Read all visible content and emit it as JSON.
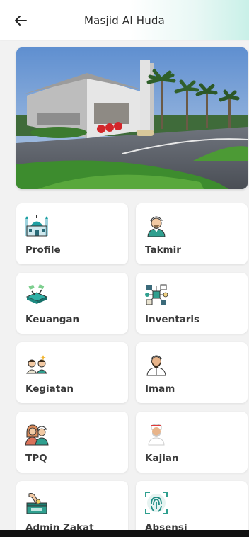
{
  "appbar": {
    "title": "Masjid Al Huda"
  },
  "menu": [
    {
      "label": "Profile",
      "icon": "mosque-icon"
    },
    {
      "label": "Takmir",
      "icon": "takmir-person-icon"
    },
    {
      "label": "Keuangan",
      "icon": "finance-icon"
    },
    {
      "label": "Inventaris",
      "icon": "inventory-network-icon"
    },
    {
      "label": "Kegiatan",
      "icon": "activity-people-icon"
    },
    {
      "label": "Imam",
      "icon": "imam-person-icon"
    },
    {
      "label": "TPQ",
      "icon": "tpq-children-icon"
    },
    {
      "label": "Kajian",
      "icon": "kajian-person-icon"
    },
    {
      "label": "Admin Zakat",
      "icon": "zakat-box-icon"
    },
    {
      "label": "Absensi",
      "icon": "fingerprint-icon"
    }
  ],
  "colors": {
    "accent": "#c9f0e8",
    "card": "#ffffff",
    "background": "#f2f2f2"
  }
}
